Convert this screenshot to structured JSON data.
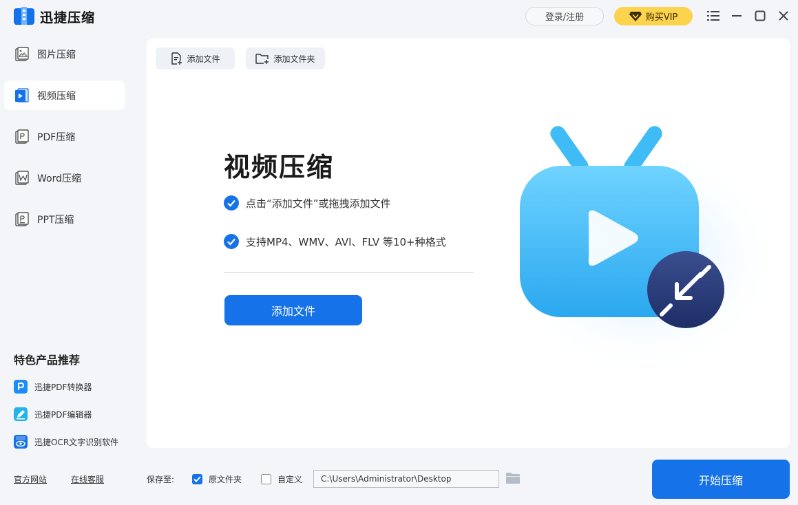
{
  "app": {
    "title": "迅捷压缩",
    "accent": "#1572e8",
    "vip_color": "#fcd34d"
  },
  "header": {
    "login_label": "登录/注册",
    "vip_label": "购买VIP",
    "controls": [
      "menu-icon",
      "minimize-icon",
      "maximize-icon",
      "close-icon"
    ]
  },
  "sidebar": {
    "items": [
      {
        "label": "图片压缩",
        "icon": "image-icon",
        "active": false
      },
      {
        "label": "视频压缩",
        "icon": "video-icon",
        "active": true
      },
      {
        "label": "PDF压缩",
        "icon": "pdf-icon",
        "active": false
      },
      {
        "label": "Word压缩",
        "icon": "word-icon",
        "active": false
      },
      {
        "label": "PPT压缩",
        "icon": "ppt-icon",
        "active": false
      }
    ],
    "featured_title": "特色产品推荐",
    "featured": [
      {
        "label": "迅捷PDF转换器",
        "icon": "pdf-converter-icon"
      },
      {
        "label": "迅捷PDF编辑器",
        "icon": "pdf-editor-icon"
      },
      {
        "label": "迅捷OCR文字识别软件",
        "icon": "ocr-icon"
      }
    ],
    "links": {
      "website": "官方网站",
      "support": "在线客服"
    }
  },
  "toolbar": {
    "add_file": "添加文件",
    "add_folder": "添加文件夹"
  },
  "main": {
    "title": "视频压缩",
    "features": [
      "点击“添加文件”或拖拽添加文件",
      "支持MP4、WMV、AVI、FLV 等10+种格式"
    ],
    "add_button": "添加文件"
  },
  "footer": {
    "save_to_label": "保存至:",
    "option_original": "原文件夹",
    "option_original_checked": true,
    "option_custom": "自定义",
    "option_custom_checked": false,
    "path_value": "C:\\Users\\Administrator\\Desktop",
    "start_button": "开始压缩"
  }
}
